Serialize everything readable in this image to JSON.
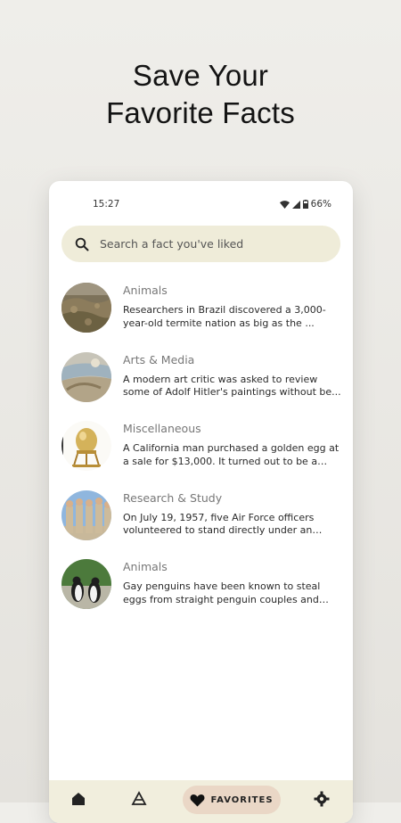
{
  "headline": {
    "line1": "Save Your",
    "line2": "Favorite Facts"
  },
  "status": {
    "time": "15:27",
    "battery": "66%"
  },
  "search": {
    "placeholder": "Search a fact you've liked"
  },
  "facts": [
    {
      "category": "Animals",
      "text": "Researchers in Brazil discovered a 3,000-year-old termite nation as big as the ...",
      "image": "termite-mounds"
    },
    {
      "category": "Arts & Media",
      "text": "A modern art critic was asked to review some of Adolf Hitler's paintings without be...",
      "image": "painting"
    },
    {
      "category": "Miscellaneous",
      "text": "A California man purchased a golden egg at a sale for $13,000. It turned out to be a rar...",
      "image": "golden-egg"
    },
    {
      "category": "Research & Study",
      "text": "On July 19, 1957, five Air Force officers volunteered to stand directly under an expl...",
      "image": "air-force-officers"
    },
    {
      "category": "Animals",
      "text": "Gay penguins have been known to steal eggs from straight penguin couples and rai...",
      "image": "penguins"
    }
  ],
  "nav": {
    "favorites_label": "FAVORITES",
    "items": [
      "home-icon",
      "explore-icon",
      "heart-icon",
      "settings-icon"
    ]
  },
  "colors": {
    "search_bg": "#efecd9",
    "nav_bg": "#f1eedd",
    "active_pill": "#ead7c6"
  }
}
